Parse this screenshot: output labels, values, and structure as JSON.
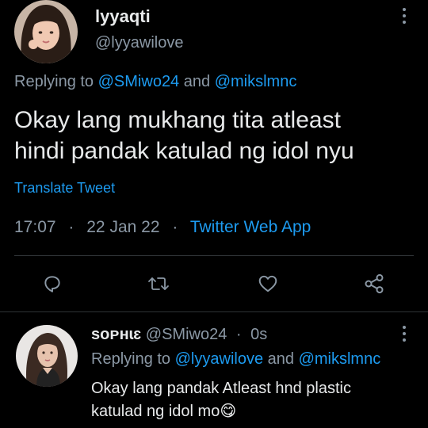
{
  "main_tweet": {
    "display_name": "lyyaqti",
    "handle": "@lyyawilove",
    "replying_prefix": "Replying to",
    "replying_users": [
      "@SMiwo24",
      "@mikslmnc"
    ],
    "replying_joiner": "and",
    "text_line1": "Okay lang mukhang tita atleast",
    "text_line2": "hindi pandak katulad ng idol nyu",
    "translate_label": "Translate Tweet",
    "time": "17:07",
    "date": "22 Jan 22",
    "dot": "·",
    "source": "Twitter Web App"
  },
  "actions": {
    "icons": [
      "reply-icon",
      "retweet-icon",
      "like-icon",
      "share-icon"
    ]
  },
  "reply_tweet": {
    "display_name": "sᴏᴘʜɩɛ",
    "handle": "@SMiwo24",
    "dot": "·",
    "age": "0s",
    "replying_prefix": "Replying to",
    "replying_users": [
      "@lyyawilove",
      "@mikslmnc"
    ],
    "replying_joiner": "and",
    "text_line1": "Okay lang pandak Atleast hnd plastic",
    "text_line2": "katulad ng idol mo",
    "emoji": "😋"
  },
  "colors": {
    "background": "#000000",
    "text": "#e7e9ea",
    "muted": "#8b98a5",
    "link": "#1d9bf0",
    "divider": "#2f3336"
  }
}
